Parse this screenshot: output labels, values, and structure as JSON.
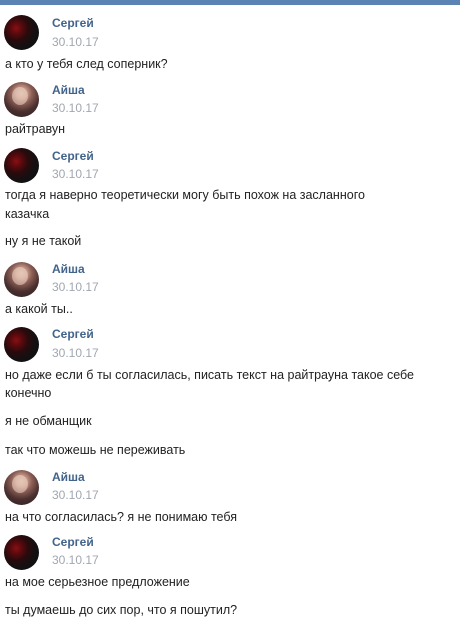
{
  "colors": {
    "top_bar": "#5b84b4",
    "name": "#42648b",
    "date": "#a0a7b0",
    "text": "#222222"
  },
  "messages": [
    {
      "author": "Сергей",
      "avatar": "sergey-avatar",
      "date": "30.10.17",
      "lines": [
        "а кто у тебя след соперник?"
      ]
    },
    {
      "author": "Айша",
      "avatar": "aisha-avatar",
      "date": "30.10.17",
      "lines": [
        "райтравун"
      ]
    },
    {
      "author": "Сергей",
      "avatar": "sergey-avatar",
      "date": "30.10.17",
      "lines": [
        "тогда я наверно теоретически могу быть похож на засланного",
        "казачка",
        "ну я не такой"
      ]
    },
    {
      "author": "Айша",
      "avatar": "aisha-avatar",
      "date": "30.10.17",
      "lines": [
        "а какой ты.."
      ]
    },
    {
      "author": "Сергей",
      "avatar": "sergey-avatar",
      "date": "30.10.17",
      "lines": [
        "но даже если б ты согласилась, писать текст на райтрауна такое себе",
        "конечно",
        "я не обманщик",
        "так что можешь не переживать"
      ]
    },
    {
      "author": "Айша",
      "avatar": "aisha-avatar",
      "date": "30.10.17",
      "lines": [
        "на что согласилась? я не понимаю тебя"
      ]
    },
    {
      "author": "Сергей",
      "avatar": "sergey-avatar",
      "date": "30.10.17",
      "lines": [
        "на мое серьезное предложение",
        "ты думаешь до сих пор, что я пошутил?"
      ]
    }
  ]
}
